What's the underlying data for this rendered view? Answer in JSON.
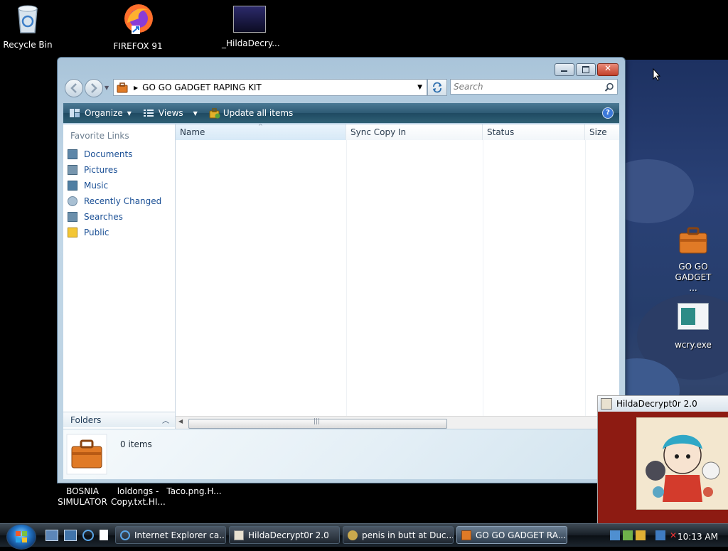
{
  "desktop": {
    "icons": [
      {
        "label": "Recycle Bin"
      },
      {
        "label": "FIREFOX 91"
      },
      {
        "label": "_HildaDecry..."
      },
      {
        "label": "GO GO GADGET ..."
      },
      {
        "label": "wcry.exe"
      },
      {
        "label": "BOSNIA SIMULATOR"
      },
      {
        "label": "loldongs - Copy.txt.HI..."
      },
      {
        "label": "Taco.png.H..."
      }
    ]
  },
  "explorer": {
    "address": "GO GO GADGET RAPING KIT",
    "search_placeholder": "Search",
    "toolbar": {
      "organize": "Organize",
      "views": "Views",
      "update_all": "Update all items"
    },
    "favorite_links_title": "Favorite Links",
    "favorite_links": [
      "Documents",
      "Pictures",
      "Music",
      "Recently Changed",
      "Searches",
      "Public"
    ],
    "folders_label": "Folders",
    "columns": [
      "Name",
      "Sync Copy In",
      "Status",
      "Size"
    ],
    "item_count": "0 items"
  },
  "hilda_window": {
    "title": "HildaDecrypt0r 2.0"
  },
  "taskbar": {
    "tasks": [
      {
        "label": "Internet Explorer ca..."
      },
      {
        "label": "HildaDecrypt0r 2.0"
      },
      {
        "label": "penis in butt at Duc..."
      },
      {
        "label": "GO GO GADGET RA..."
      }
    ],
    "clock": "10:13 AM"
  }
}
